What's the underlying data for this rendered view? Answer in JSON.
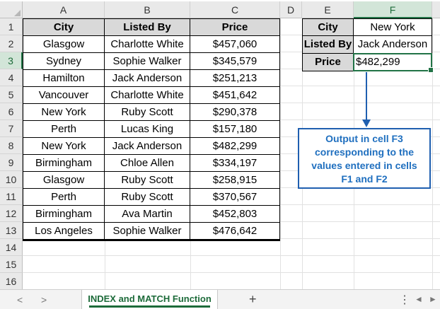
{
  "columns": [
    "A",
    "B",
    "C",
    "D",
    "E",
    "F"
  ],
  "rows": [
    "1",
    "2",
    "3",
    "4",
    "5",
    "6",
    "7",
    "8",
    "9",
    "10",
    "11",
    "12",
    "13",
    "14",
    "15",
    "16"
  ],
  "table": {
    "headers": [
      "City",
      "Listed By",
      "Price"
    ],
    "rows": [
      [
        "Glasgow",
        "Charlotte White",
        "$457,060"
      ],
      [
        "Sydney",
        "Sophie Walker",
        "$345,579"
      ],
      [
        "Hamilton",
        "Jack Anderson",
        "$251,213"
      ],
      [
        "Vancouver",
        "Charlotte White",
        "$451,642"
      ],
      [
        "New York",
        "Ruby Scott",
        "$290,378"
      ],
      [
        "Perth",
        "Lucas King",
        "$157,180"
      ],
      [
        "New York",
        "Jack Anderson",
        "$482,299"
      ],
      [
        "Birmingham",
        "Chloe Allen",
        "$334,197"
      ],
      [
        "Glasgow",
        "Ruby Scott",
        "$258,915"
      ],
      [
        "Perth",
        "Ruby Scott",
        "$370,567"
      ],
      [
        "Birmingham",
        "Ava Martin",
        "$452,803"
      ],
      [
        "Los Angeles",
        "Sophie Walker",
        "$476,642"
      ]
    ]
  },
  "lookup": {
    "labels": [
      "City",
      "Listed By",
      "Price"
    ],
    "values": [
      "New York",
      "Jack Anderson",
      "$482,299"
    ]
  },
  "callout": [
    "Output in cell F3",
    "corresponding to the",
    "values entered in cells",
    "F1 and F2"
  ],
  "tabs": {
    "prev": "<",
    "next": ">",
    "active_sheet": "INDEX and MATCH Function",
    "add": "+",
    "more": "⋮",
    "scroll_left": "◄",
    "scroll_right": "►"
  },
  "colors": {
    "accent": "#217346",
    "callout": "#1f5fb0",
    "header_fill": "#d9d9d9"
  }
}
